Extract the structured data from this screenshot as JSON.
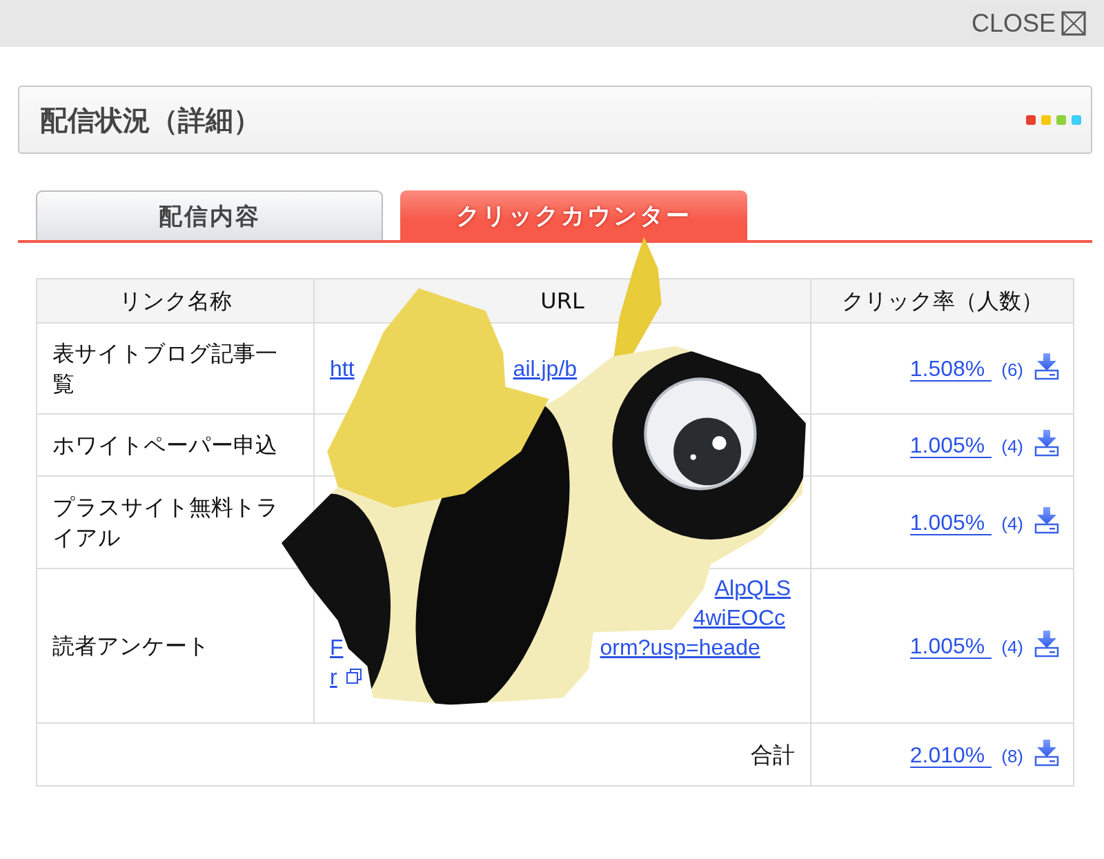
{
  "window": {
    "close_label": "CLOSE"
  },
  "header": {
    "title": "配信状況（詳細）",
    "dots": [
      {
        "color": "#e8412f"
      },
      {
        "color": "#f7c90a"
      },
      {
        "color": "#8fd13f"
      },
      {
        "color": "#3fd0f5"
      }
    ]
  },
  "tabs": [
    {
      "label": "配信内容",
      "selected": false
    },
    {
      "label": "クリックカウンター",
      "selected": true
    }
  ],
  "table": {
    "columns": [
      "リンク名称",
      "URL",
      "クリック率（人数）"
    ],
    "rows": [
      {
        "name": "表サイトブログ記事一覧",
        "url_lines": [
          [
            "htt",
            "ail.jp/b"
          ]
        ],
        "rate": "1.508%",
        "count": "(6)"
      },
      {
        "name": "ホワイトペーパー申込",
        "rate": "1.005%",
        "count": "(4)"
      },
      {
        "name": "プラスサイト無料トライアル",
        "rate": "1.005%",
        "count": "(4)"
      },
      {
        "name": "読者アンケート",
        "url_lines": [
          [
            "AlpQLS"
          ],
          [
            "4wiEOCc"
          ],
          [
            "F",
            "orm?usp=heade"
          ],
          [
            "r"
          ]
        ],
        "copy_icon": true,
        "rate": "1.005%",
        "count": "(4)"
      }
    ],
    "total": {
      "label": "合計",
      "rate": "2.010%",
      "count": "(8)"
    }
  }
}
